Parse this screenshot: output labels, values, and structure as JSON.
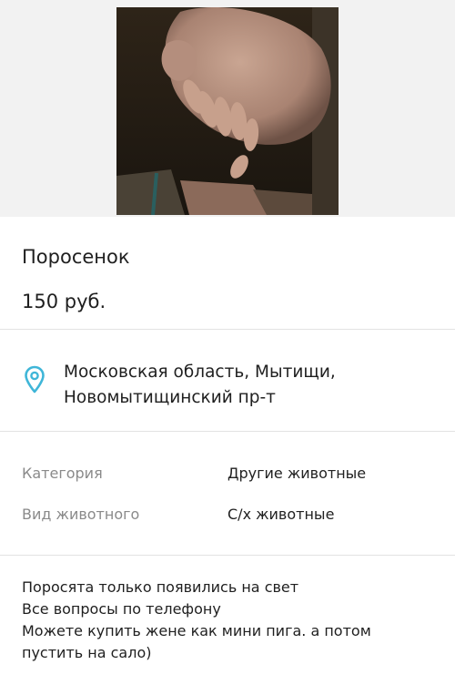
{
  "listing": {
    "title": "Поросенок",
    "price": "150 руб.",
    "location": {
      "icon": "location-pin-icon",
      "line1": "Московская область, Мытищи,",
      "line2": "Новомытищинский пр-т"
    },
    "attributes": [
      {
        "label": "Категория",
        "value": "Другие животные"
      },
      {
        "label": "Вид животного",
        "value": "С/х животные"
      }
    ],
    "description_lines": [
      "Поросята только появились на свет",
      "Все вопросы по телефону",
      "Можете купить жене как мини пига. а потом",
      "пустить на сало)"
    ]
  },
  "colors": {
    "accent_pin": "#3fb6d8",
    "label_gray": "#8a8a8a"
  }
}
